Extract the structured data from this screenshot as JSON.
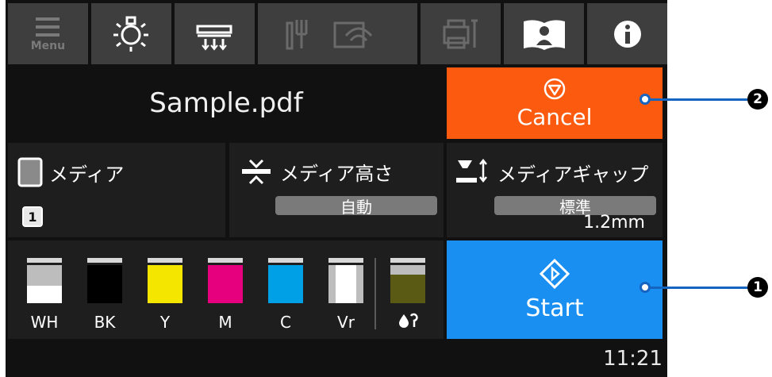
{
  "toolbar": {
    "menu_label": "Menu",
    "icons": [
      "menu-icon",
      "light-icon",
      "media-feed-icon",
      "network-icon",
      "maintenance-icon",
      "manual-icon",
      "info-icon"
    ]
  },
  "job": {
    "file_name": "Sample.pdf",
    "cancel_label": "Cancel"
  },
  "media": {
    "media_label": "メディア",
    "media_number": "1",
    "height_label": "メディア高さ",
    "height_value": "自動",
    "gap_label": "メディアギャップ",
    "gap_mode": "標準",
    "gap_value": "1.2mm"
  },
  "inks": [
    {
      "label": "WH",
      "color": "#ffffff",
      "level": 0.45
    },
    {
      "label": "BK",
      "color": "#000000",
      "level": 1.0
    },
    {
      "label": "Y",
      "color": "#f5e600",
      "level": 1.0
    },
    {
      "label": "M",
      "color": "#e6007e",
      "level": 1.0
    },
    {
      "label": "C",
      "color": "#00a0e6",
      "level": 1.0
    },
    {
      "label": "Vr",
      "color": "#ffffff",
      "level": 1.0
    },
    {
      "label": "",
      "color": "#5a5a14",
      "level": 0.75
    }
  ],
  "start_label": "Start",
  "status": {
    "time": "11:21"
  },
  "callouts": {
    "start": "1",
    "cancel": "2"
  },
  "colors": {
    "cancel": "#fb5a0f",
    "start": "#1a8ff2",
    "callout": "#1565c0"
  }
}
